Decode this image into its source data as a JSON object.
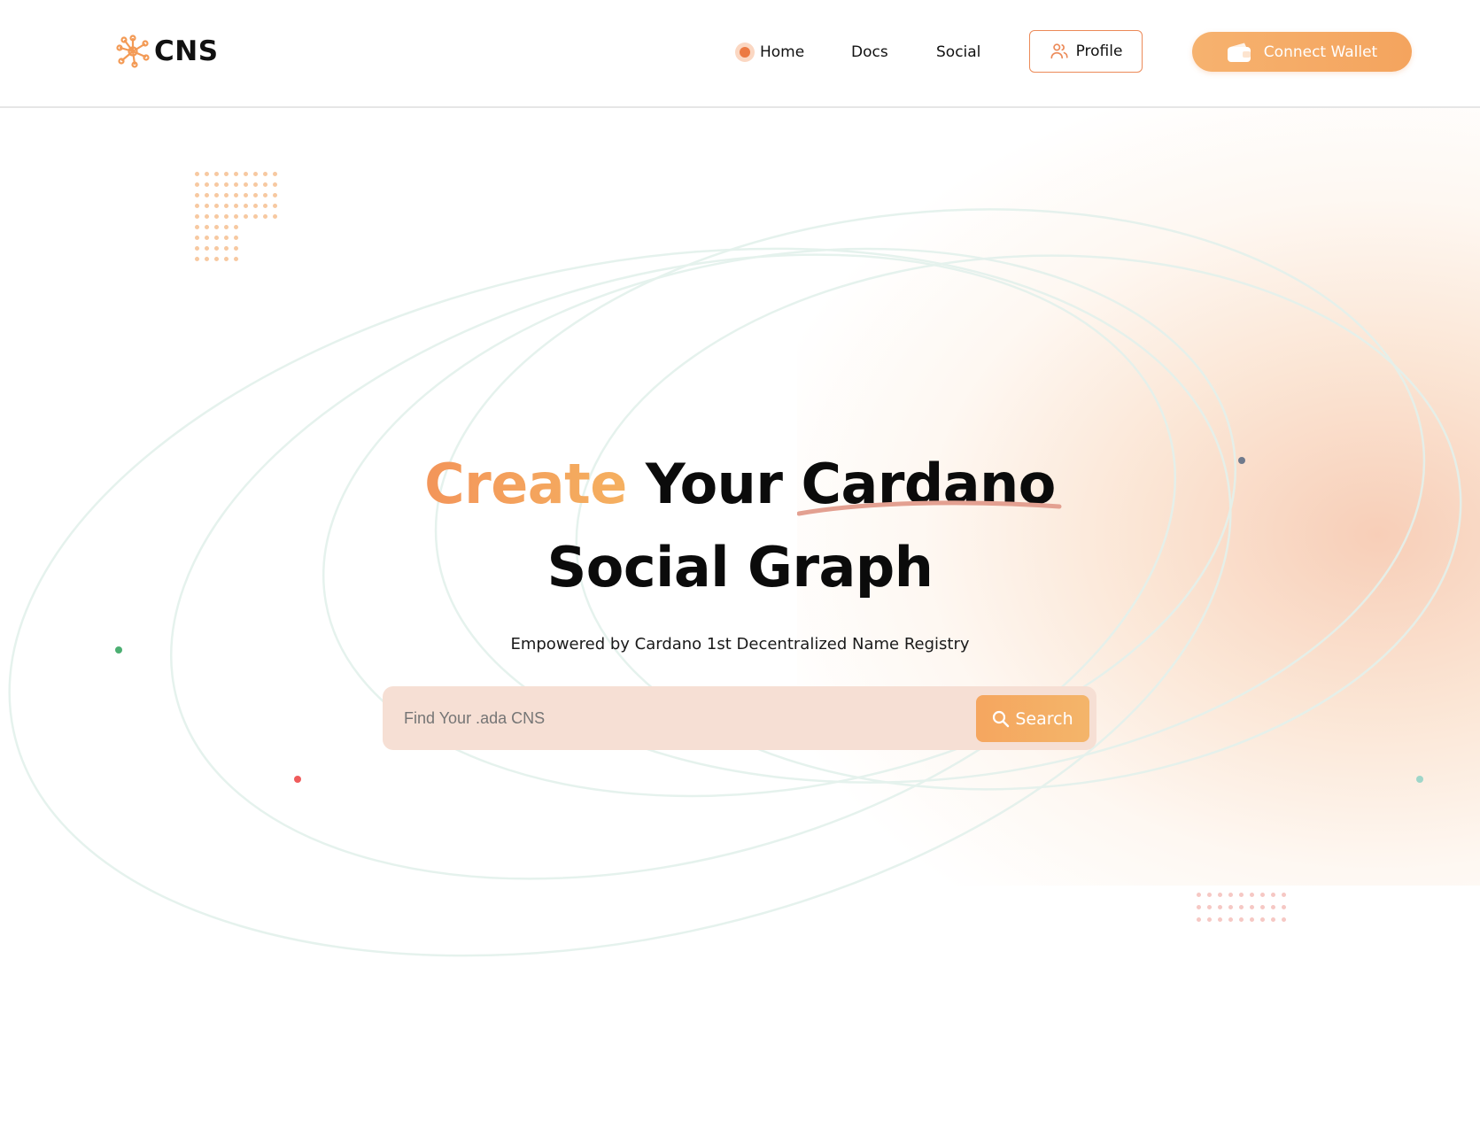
{
  "brand": {
    "name": "CNS",
    "accent_color": "#f39a55"
  },
  "nav": {
    "home": "Home",
    "docs": "Docs",
    "social": "Social",
    "profile": "Profile",
    "connect_wallet": "Connect Wallet"
  },
  "hero": {
    "title_accent": "Create",
    "title_mid": " Your ",
    "title_underlined": "Cardano",
    "title_line2": "Social Graph",
    "subtitle": "Empowered by Cardano 1st Decentralized Name Registry"
  },
  "search": {
    "placeholder": "Find Your .ada CNS",
    "button_label": "Search"
  },
  "icons": {
    "logo": "network-nodes-icon",
    "home_indicator": "active-dot-icon",
    "profile": "users-icon",
    "wallet": "wallet-icon",
    "search": "magnifier-icon"
  }
}
